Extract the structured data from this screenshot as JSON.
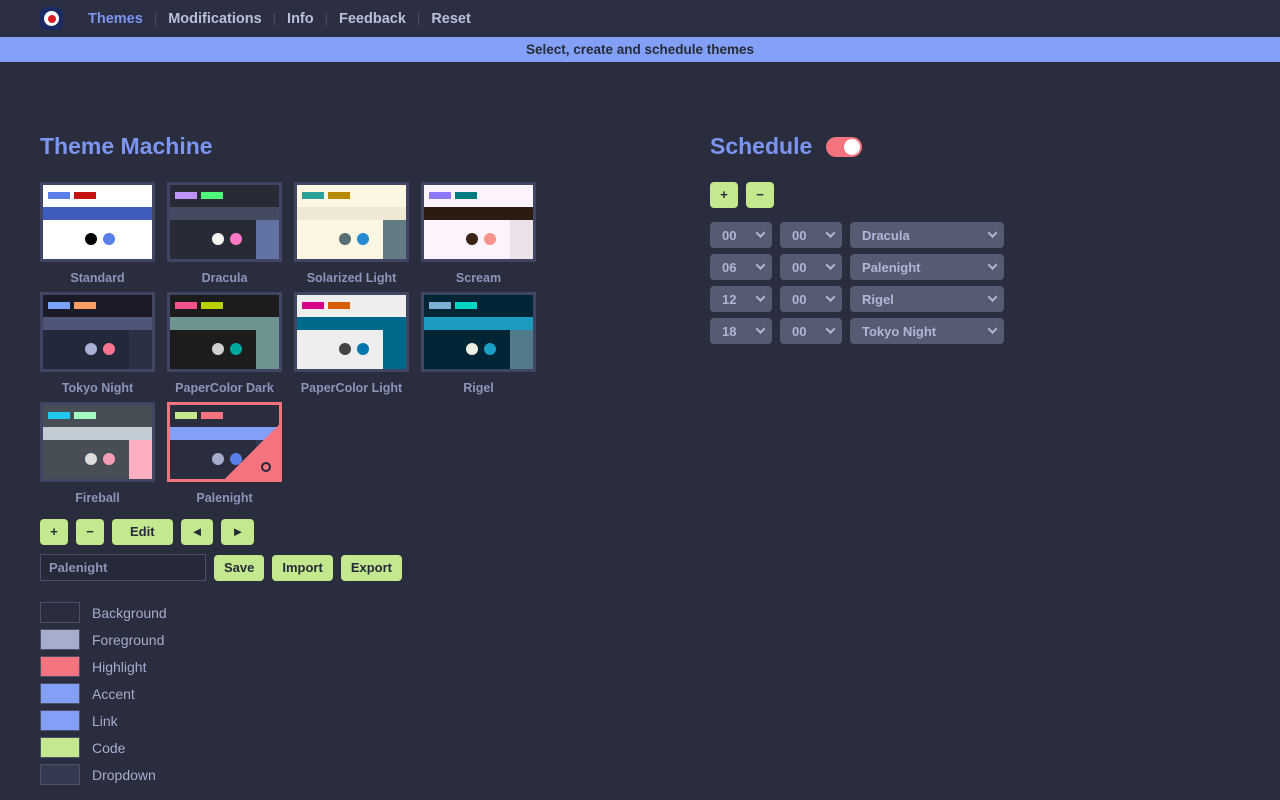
{
  "nav": {
    "logo_icon": "target-dot-icon",
    "separator": "|",
    "items": [
      {
        "label": "Themes",
        "active": true
      },
      {
        "label": "Modifications",
        "active": false
      },
      {
        "label": "Info",
        "active": false
      },
      {
        "label": "Feedback",
        "active": false
      },
      {
        "label": "Reset",
        "active": false
      }
    ]
  },
  "banner": {
    "text": "Select, create and schedule themes"
  },
  "themes_panel": {
    "title": "Theme Machine",
    "selected": "Palenight",
    "cards": [
      {
        "label": "Standard",
        "selected": false,
        "top": "#ffffff",
        "accent": "#3f5dbd",
        "accent_w": "100%",
        "body": "#ffffff",
        "side": "#3f5dbd",
        "side_on": false,
        "bar1": "#5a7fe8",
        "bar2": "#c41111",
        "dot1": "#000000",
        "dot2": "#5a7fe8"
      },
      {
        "label": "Dracula",
        "selected": false,
        "top": "#282a36",
        "accent": "#454a63",
        "accent_w": "100%",
        "body": "#282a36",
        "side": "#6272a4",
        "side_on": true,
        "bar1": "#bd93f9",
        "bar2": "#50fa7b",
        "dot1": "#f8f8f2",
        "dot2": "#ff79c6"
      },
      {
        "label": "Solarized Light",
        "selected": false,
        "top": "#fdf6e3",
        "accent": "#eee8d5",
        "accent_w": "100%",
        "body": "#fdf6e3",
        "side": "#657b83",
        "side_on": true,
        "bar1": "#2aa198",
        "bar2": "#b58900",
        "dot1": "#586e75",
        "dot2": "#268bd2"
      },
      {
        "label": "Scream",
        "selected": false,
        "top": "#fdf3fd",
        "accent": "#2b1b10",
        "accent_w": "100%",
        "body": "#fdf3fd",
        "side": "#ece3ea",
        "side_on": true,
        "bar1": "#8d78fa",
        "bar2": "#007b84",
        "dot1": "#3b2314",
        "dot2": "#fb938a"
      },
      {
        "label": "Tokyo Night",
        "selected": false,
        "top": "#1a1b26",
        "accent": "#4e5579",
        "accent_w": "100%",
        "body": "#24283b",
        "side": "#2b2f44",
        "side_on": true,
        "bar1": "#7aa2f7",
        "bar2": "#ff9e64",
        "dot1": "#a9b1d6",
        "dot2": "#f7768e"
      },
      {
        "label": "PaperColor Dark",
        "selected": false,
        "top": "#1c1c1c",
        "accent": "#6e9492",
        "accent_w": "100%",
        "body": "#1c1c1c",
        "side": "#6e9492",
        "side_on": true,
        "bar1": "#f4518f",
        "bar2": "#b8d000",
        "dot1": "#d0d0d0",
        "dot2": "#00a8a0"
      },
      {
        "label": "PaperColor Light",
        "selected": false,
        "top": "#eeeeee",
        "accent": "#00688a",
        "accent_w": "100%",
        "body": "#eeeeee",
        "side": "#00688a",
        "side_on": true,
        "bar1": "#d60089",
        "bar2": "#d75f00",
        "dot1": "#444444",
        "dot2": "#0075b0"
      },
      {
        "label": "Rigel",
        "selected": false,
        "top": "#002635",
        "accent": "#1d9bc0",
        "accent_w": "100%",
        "body": "#002635",
        "side": "#527b8a",
        "side_on": true,
        "bar1": "#7cb0d4",
        "bar2": "#00d6c3",
        "dot1": "#f0efe3",
        "dot2": "#1b9fc7"
      },
      {
        "label": "Fireball",
        "selected": false,
        "top": "#474e55",
        "accent": "#c2ccd4",
        "accent_w": "100%",
        "body": "#474e55",
        "side": "#fdaec1",
        "side_on": true,
        "bar1": "#20c8f0",
        "bar2": "#a4fbc4",
        "dot1": "#dcdcdc",
        "dot2": "#f4a0b4"
      },
      {
        "label": "Palenight",
        "selected": true,
        "top": "#292d3e",
        "accent": "#82a0f5",
        "accent_w": "100%",
        "body": "#292d3e",
        "side": "#343a50",
        "side_on": true,
        "bar1": "#c3e88d",
        "bar2": "#f4737f",
        "dot1": "#a6adcd",
        "dot2": "#5a7fe8"
      }
    ],
    "controls": {
      "add_label": "+",
      "remove_label": "−",
      "edit_label": "Edit",
      "prev_label": "◄",
      "next_label": "►"
    },
    "save_row": {
      "name_value": "Palenight",
      "name_placeholder": "Palenight",
      "save_label": "Save",
      "import_label": "Import",
      "export_label": "Export"
    },
    "swatches": [
      {
        "label": "Background",
        "color": "#292d3e"
      },
      {
        "label": "Foreground",
        "color": "#a6adcd"
      },
      {
        "label": "Highlight",
        "color": "#f4737f"
      },
      {
        "label": "Accent",
        "color": "#82a0f5"
      },
      {
        "label": "Link",
        "color": "#82a0f5"
      },
      {
        "label": "Code",
        "color": "#c3e88d"
      },
      {
        "label": "Dropdown",
        "color": "#343a50"
      }
    ]
  },
  "schedule_panel": {
    "title": "Schedule",
    "enabled": true,
    "add_label": "+",
    "remove_label": "−",
    "rows": [
      {
        "hour": "00",
        "minute": "00",
        "theme": "Dracula"
      },
      {
        "hour": "06",
        "minute": "00",
        "theme": "Palenight"
      },
      {
        "hour": "12",
        "minute": "00",
        "theme": "Rigel"
      },
      {
        "hour": "18",
        "minute": "00",
        "theme": "Tokyo Night"
      }
    ]
  },
  "colors": {
    "page_bg": "#292d3e",
    "nav_bg": "#2b2f41",
    "banner_bg": "#82a0f5",
    "accent": "#7b95f0",
    "button_bg": "#c3e88d",
    "highlight": "#f4737f",
    "dropdown_bg": "#555b70"
  }
}
